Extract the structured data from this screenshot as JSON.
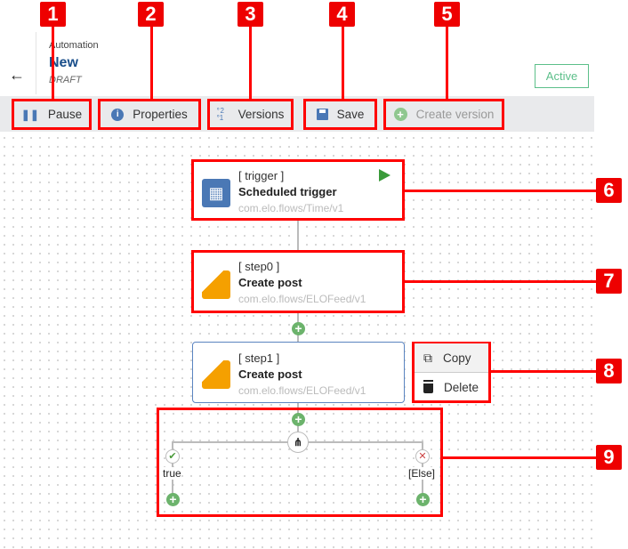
{
  "header": {
    "back_icon": "arrow-left-icon",
    "section": "Automation",
    "title": "New",
    "state": "DRAFT",
    "status": "Active",
    "status_color": "#5cbf8a"
  },
  "toolbar": [
    {
      "label": "Pause",
      "icon": "pause-icon"
    },
    {
      "label": "Properties",
      "icon": "info-icon"
    },
    {
      "label": "Versions",
      "icon": "versions-icon"
    },
    {
      "label": "Save",
      "icon": "save-icon"
    },
    {
      "label": "Create version",
      "icon": "plus-circle-icon",
      "disabled": true
    }
  ],
  "callouts": [
    "1",
    "2",
    "3",
    "4",
    "5",
    "6",
    "7",
    "8",
    "9"
  ],
  "nodes": [
    {
      "id": "[ trigger ]",
      "name": "Scheduled trigger",
      "type": "com.elo.flows/Time/v1",
      "icon": "calendar-clock-icon"
    },
    {
      "id": "[ step0 ]",
      "name": "Create post",
      "type": "com.elo.flows/ELOFeed/v1",
      "icon": "elo-feed-icon"
    },
    {
      "id": "[ step1 ]",
      "name": "Create post",
      "type": "com.elo.flows/ELOFeed/v1",
      "icon": "elo-feed-icon"
    }
  ],
  "context_menu": [
    {
      "label": "Copy",
      "icon": "copy-icon"
    },
    {
      "label": "Delete",
      "icon": "trash-icon"
    }
  ],
  "branches": {
    "true_label": "true",
    "else_label": "[Else]"
  },
  "colors": {
    "accent": "#1a4f8b",
    "callout": "#ee0000",
    "add": "#6cb36c",
    "trigger_icon": "#4a78b5",
    "feed_icon": "#f5a000"
  }
}
